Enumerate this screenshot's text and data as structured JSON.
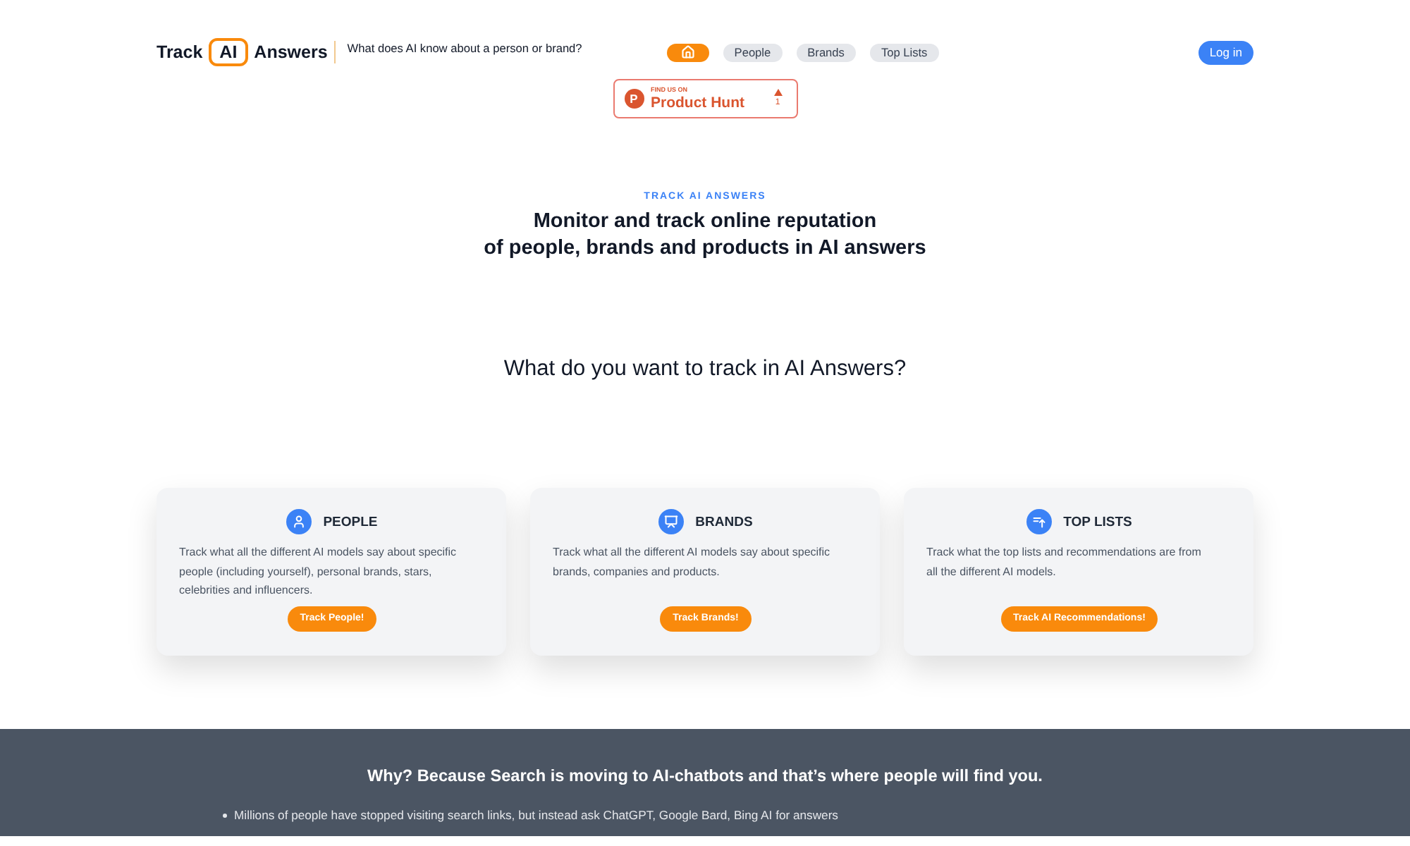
{
  "header": {
    "logo": {
      "before": "Track",
      "boxed": "AI",
      "after": "Answers"
    },
    "tagline": "What does AI know about a person or brand?",
    "nav": [
      {
        "kind": "home",
        "selected": true
      },
      {
        "kind": "text",
        "label": "People",
        "selected": false
      },
      {
        "kind": "text",
        "label": "Brands",
        "selected": false
      },
      {
        "kind": "text",
        "label": "Top Lists",
        "selected": false
      }
    ],
    "login_button": "Log in"
  },
  "product_hunt_badge": {
    "logo_letter": "P",
    "eyebrow": "FIND US ON",
    "name": "Product Hunt",
    "votes": "1"
  },
  "hero": {
    "eyebrow": "TRACK AI ANSWERS",
    "title_lines": [
      "Monitor and track online reputation",
      "of people, brands and products in AI answers"
    ]
  },
  "question": "What do you want to track in AI Answers?",
  "cards": [
    {
      "kind": "people",
      "title": "PEOPLE",
      "description": "Track what all the different AI models say about specific people (including yourself), personal brands, stars, celebrities and influencers.",
      "button": "Track People!"
    },
    {
      "kind": "brands",
      "title": "BRANDS",
      "description": "Track what all the different AI models say about specific brands, companies and products.",
      "button": "Track Brands!"
    },
    {
      "kind": "top_lists",
      "title": "TOP LISTS",
      "description": "Track what the top lists and recommendations are from all the different AI models.",
      "button": "Track AI Recommendations!"
    }
  ],
  "why_section": {
    "heading": "Why? Because Search is moving to AI-chatbots and that’s where people will find you.",
    "bullets": [
      "Millions of people have stopped visiting search links, but instead ask ChatGPT, Google Bard, Bing AI for answers"
    ]
  }
}
